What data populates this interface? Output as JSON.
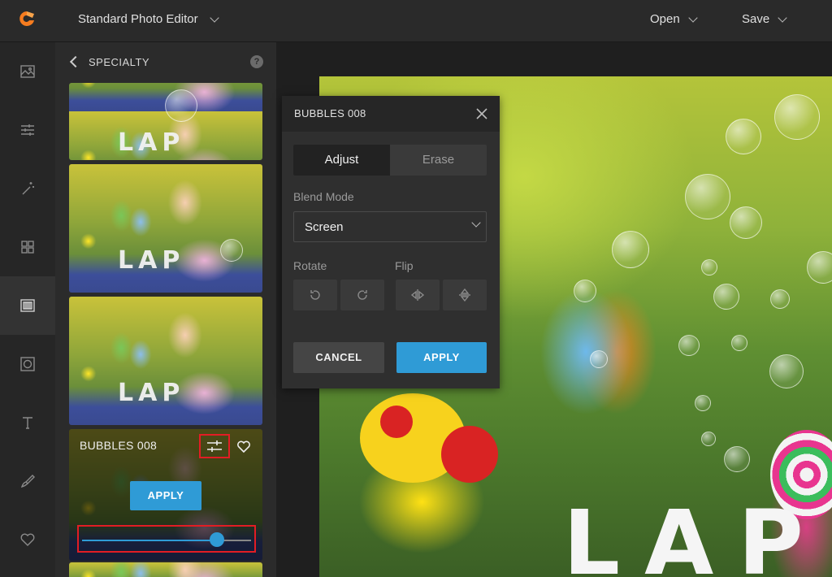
{
  "header": {
    "app_title": "Standard Photo Editor",
    "open_label": "Open",
    "save_label": "Save"
  },
  "rail": {
    "items": [
      "image-icon",
      "sliders-icon",
      "magic-wand-icon",
      "grid-icon",
      "overlay-icon",
      "frame-icon",
      "text-icon",
      "brush-icon",
      "heart-icon"
    ],
    "active_index": 4
  },
  "panel": {
    "title": "SPECIALTY",
    "help_label": "?",
    "thumb_text": "LAP",
    "active_effect": {
      "name": "BUBBLES 008",
      "apply_label": "APPLY",
      "strength": 0.8
    }
  },
  "dialog": {
    "title": "BUBBLES 008",
    "tabs": [
      "Adjust",
      "Erase"
    ],
    "selected_tab": "Adjust",
    "blend_mode_label": "Blend Mode",
    "blend_mode_value": "Screen",
    "rotate_label": "Rotate",
    "flip_label": "Flip",
    "cancel_label": "CANCEL",
    "apply_label": "APPLY"
  },
  "canvas": {
    "photo_text": "LAP"
  },
  "colors": {
    "accent": "#2f9bd6",
    "highlight": "#e21d24",
    "logo": "#f57c1f"
  }
}
